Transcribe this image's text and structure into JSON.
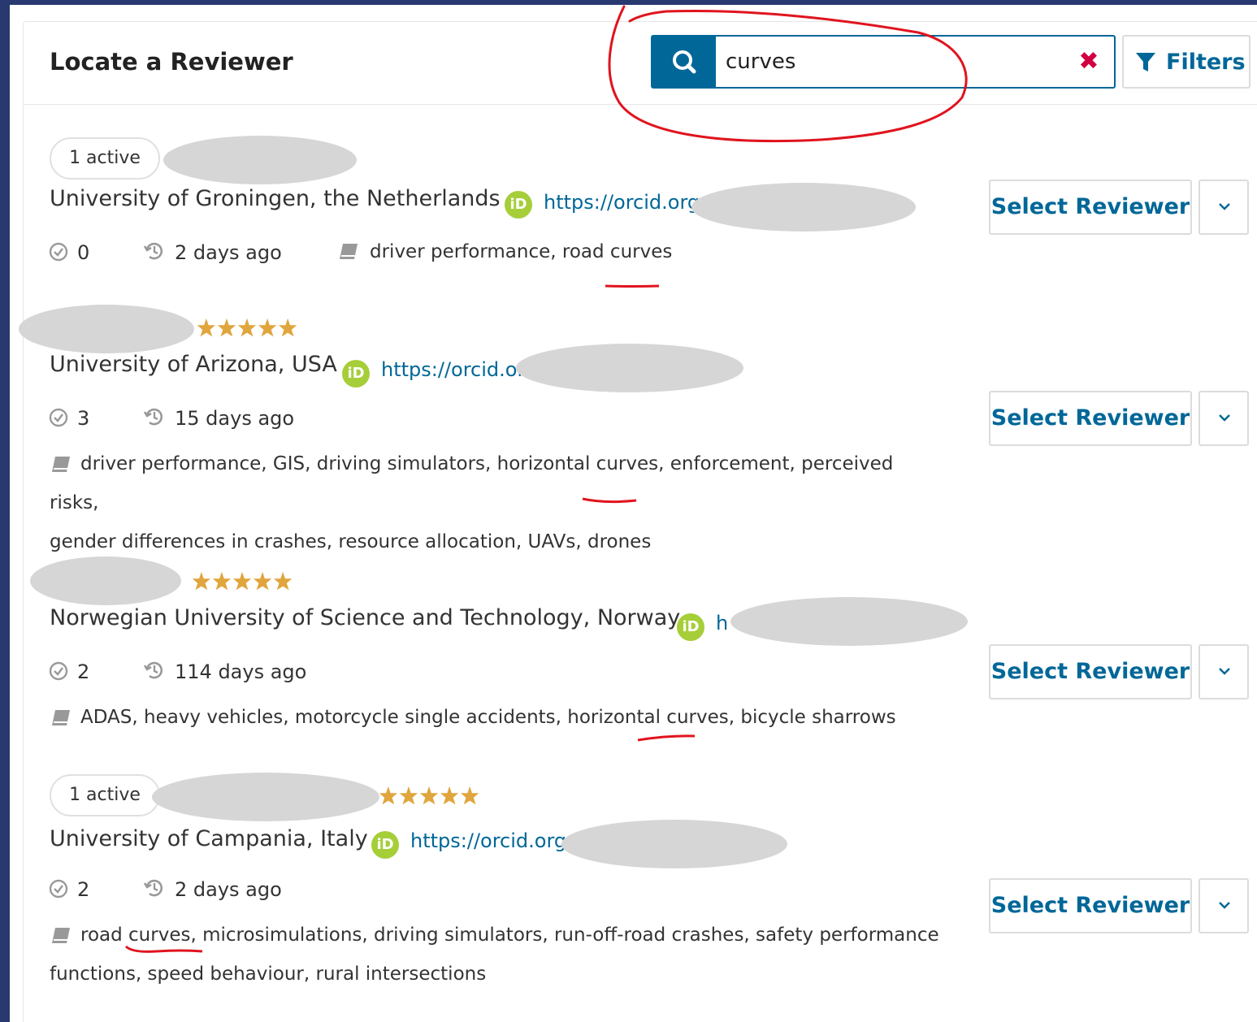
{
  "header": {
    "title": "Locate a Reviewer",
    "search_value": "curves",
    "filters_label": "Filters"
  },
  "reviewers": [
    {
      "badge": "1 active",
      "affiliation": "University of Groningen, the Netherlands",
      "orcid_text": "https://orcid.org",
      "completed": "0",
      "last_active": "2 days ago",
      "interests_line1": "driver performance, road curves",
      "interests_line2": "",
      "select_label": "Select Reviewer"
    },
    {
      "rating_stars": 5,
      "affiliation": "University of Arizona, USA",
      "orcid_text": "https://orcid.or",
      "completed": "3",
      "last_active": "15 days ago",
      "interests_line1": "driver performance, GIS, driving simulators, horizontal curves, enforcement, perceived risks,",
      "interests_line2": "gender differences in crashes, resource allocation, UAVs, drones",
      "select_label": "Select Reviewer"
    },
    {
      "rating_stars": 5,
      "affiliation": "Norwegian University of Science and Technology, Norway",
      "orcid_text": "h",
      "completed": "2",
      "last_active": "114 days ago",
      "interests_line1": "ADAS, heavy vehicles, motorcycle single accidents, horizontal curves, bicycle sharrows",
      "interests_line2": "",
      "select_label": "Select Reviewer"
    },
    {
      "badge": "1 active",
      "rating_stars": 5,
      "affiliation": "University of Campania, Italy",
      "orcid_text": "https://orcid.org",
      "completed": "2",
      "last_active": "2 days ago",
      "interests_line1": "road curves, microsimulations, driving simulators, run-off-road crashes, safety performance",
      "interests_line2": "functions, speed behaviour, rural intersections",
      "select_label": "Select Reviewer"
    }
  ],
  "icons": {
    "search": "search-icon",
    "clear": "close-icon",
    "filter": "filter-icon",
    "orcid": "orcid-icon",
    "completed": "check-circle-icon",
    "history": "history-icon",
    "interests": "book-icon",
    "more": "chevron-down-icon",
    "rating": "star-icon"
  },
  "colors": {
    "accent": "#006798",
    "orcid": "#a6ce39",
    "star": "#e0a53d",
    "clear": "#d00040",
    "annotation": "#e0141e",
    "background": "#27396f"
  }
}
